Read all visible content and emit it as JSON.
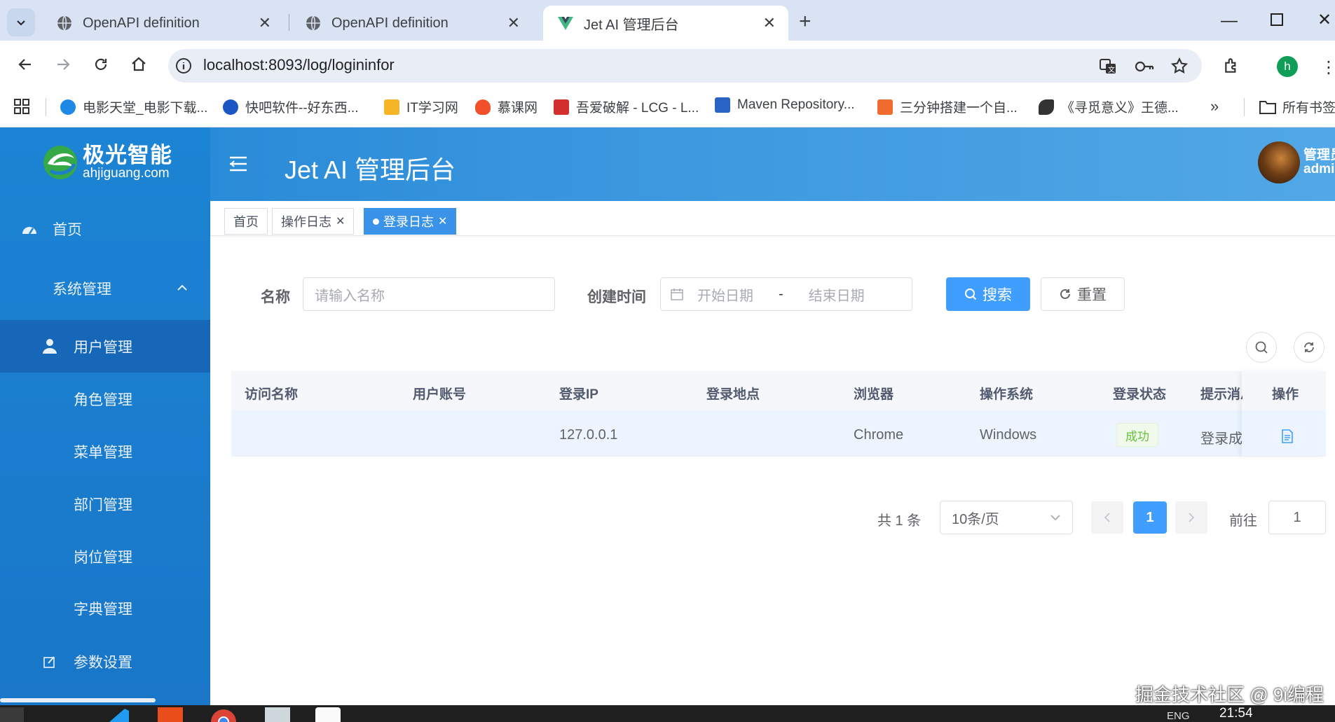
{
  "browser": {
    "tabs": [
      {
        "title": "OpenAPI definition",
        "active": false
      },
      {
        "title": "OpenAPI definition",
        "active": false
      },
      {
        "title": "Jet AI 管理后台",
        "active": true
      }
    ],
    "url_host": "localhost",
    "url_rest": ":8093/log/logininfor",
    "profile_initial": "h",
    "bookmarks": [
      {
        "label": "电影天堂_电影下载...",
        "icon_color": "#1e88e5"
      },
      {
        "label": "快吧软件--好东西...",
        "icon_color": "#1a56c4"
      },
      {
        "label": "IT学习网",
        "icon_color": "#f6b526"
      },
      {
        "label": "慕课网",
        "icon_color": "#f0512b"
      },
      {
        "label": "吾爱破解 - LCG - L...",
        "icon_color": "#d32f2f"
      },
      {
        "label": "Maven Repository...",
        "icon_color": "#2964c4"
      },
      {
        "label": "三分钟搭建一个自...",
        "icon_color": "#ef6b2e"
      },
      {
        "label": "《寻觅意义》王德...",
        "icon_color": "#333333"
      }
    ],
    "bookmarks_overflow": "»",
    "all_bookmarks": "所有书签"
  },
  "app": {
    "logo_cn": "极光智能",
    "logo_en": "ahjiguang.com",
    "title": "Jet AI 管理后台",
    "user_role": "管理员",
    "user_name": "admin",
    "menu": [
      {
        "label": "首页",
        "icon": "dashboard-icon"
      },
      {
        "label": "系统管理",
        "icon": "",
        "expanded": true
      },
      {
        "label": "用户管理",
        "icon": "user-icon",
        "active": true
      },
      {
        "label": "角色管理",
        "icon": ""
      },
      {
        "label": "菜单管理",
        "icon": ""
      },
      {
        "label": "部门管理",
        "icon": ""
      },
      {
        "label": "岗位管理",
        "icon": ""
      },
      {
        "label": "字典管理",
        "icon": ""
      },
      {
        "label": "参数设置",
        "icon": "edit-icon"
      }
    ],
    "tags": [
      {
        "label": "首页",
        "closable": false,
        "active": false
      },
      {
        "label": "操作日志",
        "closable": true,
        "active": false
      },
      {
        "label": "登录日志",
        "closable": true,
        "active": true
      }
    ]
  },
  "search": {
    "name_label": "名称",
    "name_placeholder": "请输入名称",
    "time_label": "创建时间",
    "start_placeholder": "开始日期",
    "range_sep": "-",
    "end_placeholder": "结束日期",
    "search_btn": "搜索",
    "reset_btn": "重置"
  },
  "table": {
    "columns": [
      "访问名称",
      "用户账号",
      "登录IP",
      "登录地点",
      "浏览器",
      "操作系统",
      "登录状态",
      "提示消息",
      "操作"
    ],
    "rows": [
      {
        "name": "",
        "account": "",
        "ip": "127.0.0.1",
        "location": "",
        "browser": "Chrome",
        "os": "Windows",
        "status": "成功",
        "message": "登录成功",
        "action_icon": "document-icon"
      }
    ]
  },
  "pagination": {
    "total_text": "共 1 条",
    "page_size": "10条/页",
    "current_page": "1",
    "goto_label": "前往",
    "goto_value": "1"
  },
  "watermark": "掘金技术社区 @ 9i编程",
  "taskbar": {
    "time": "21:54",
    "lang": "ENG"
  },
  "colors": {
    "sidebar": "#1c84d4",
    "primary": "#409eff",
    "success": "#67c23a",
    "topbar": "#3d98df"
  }
}
